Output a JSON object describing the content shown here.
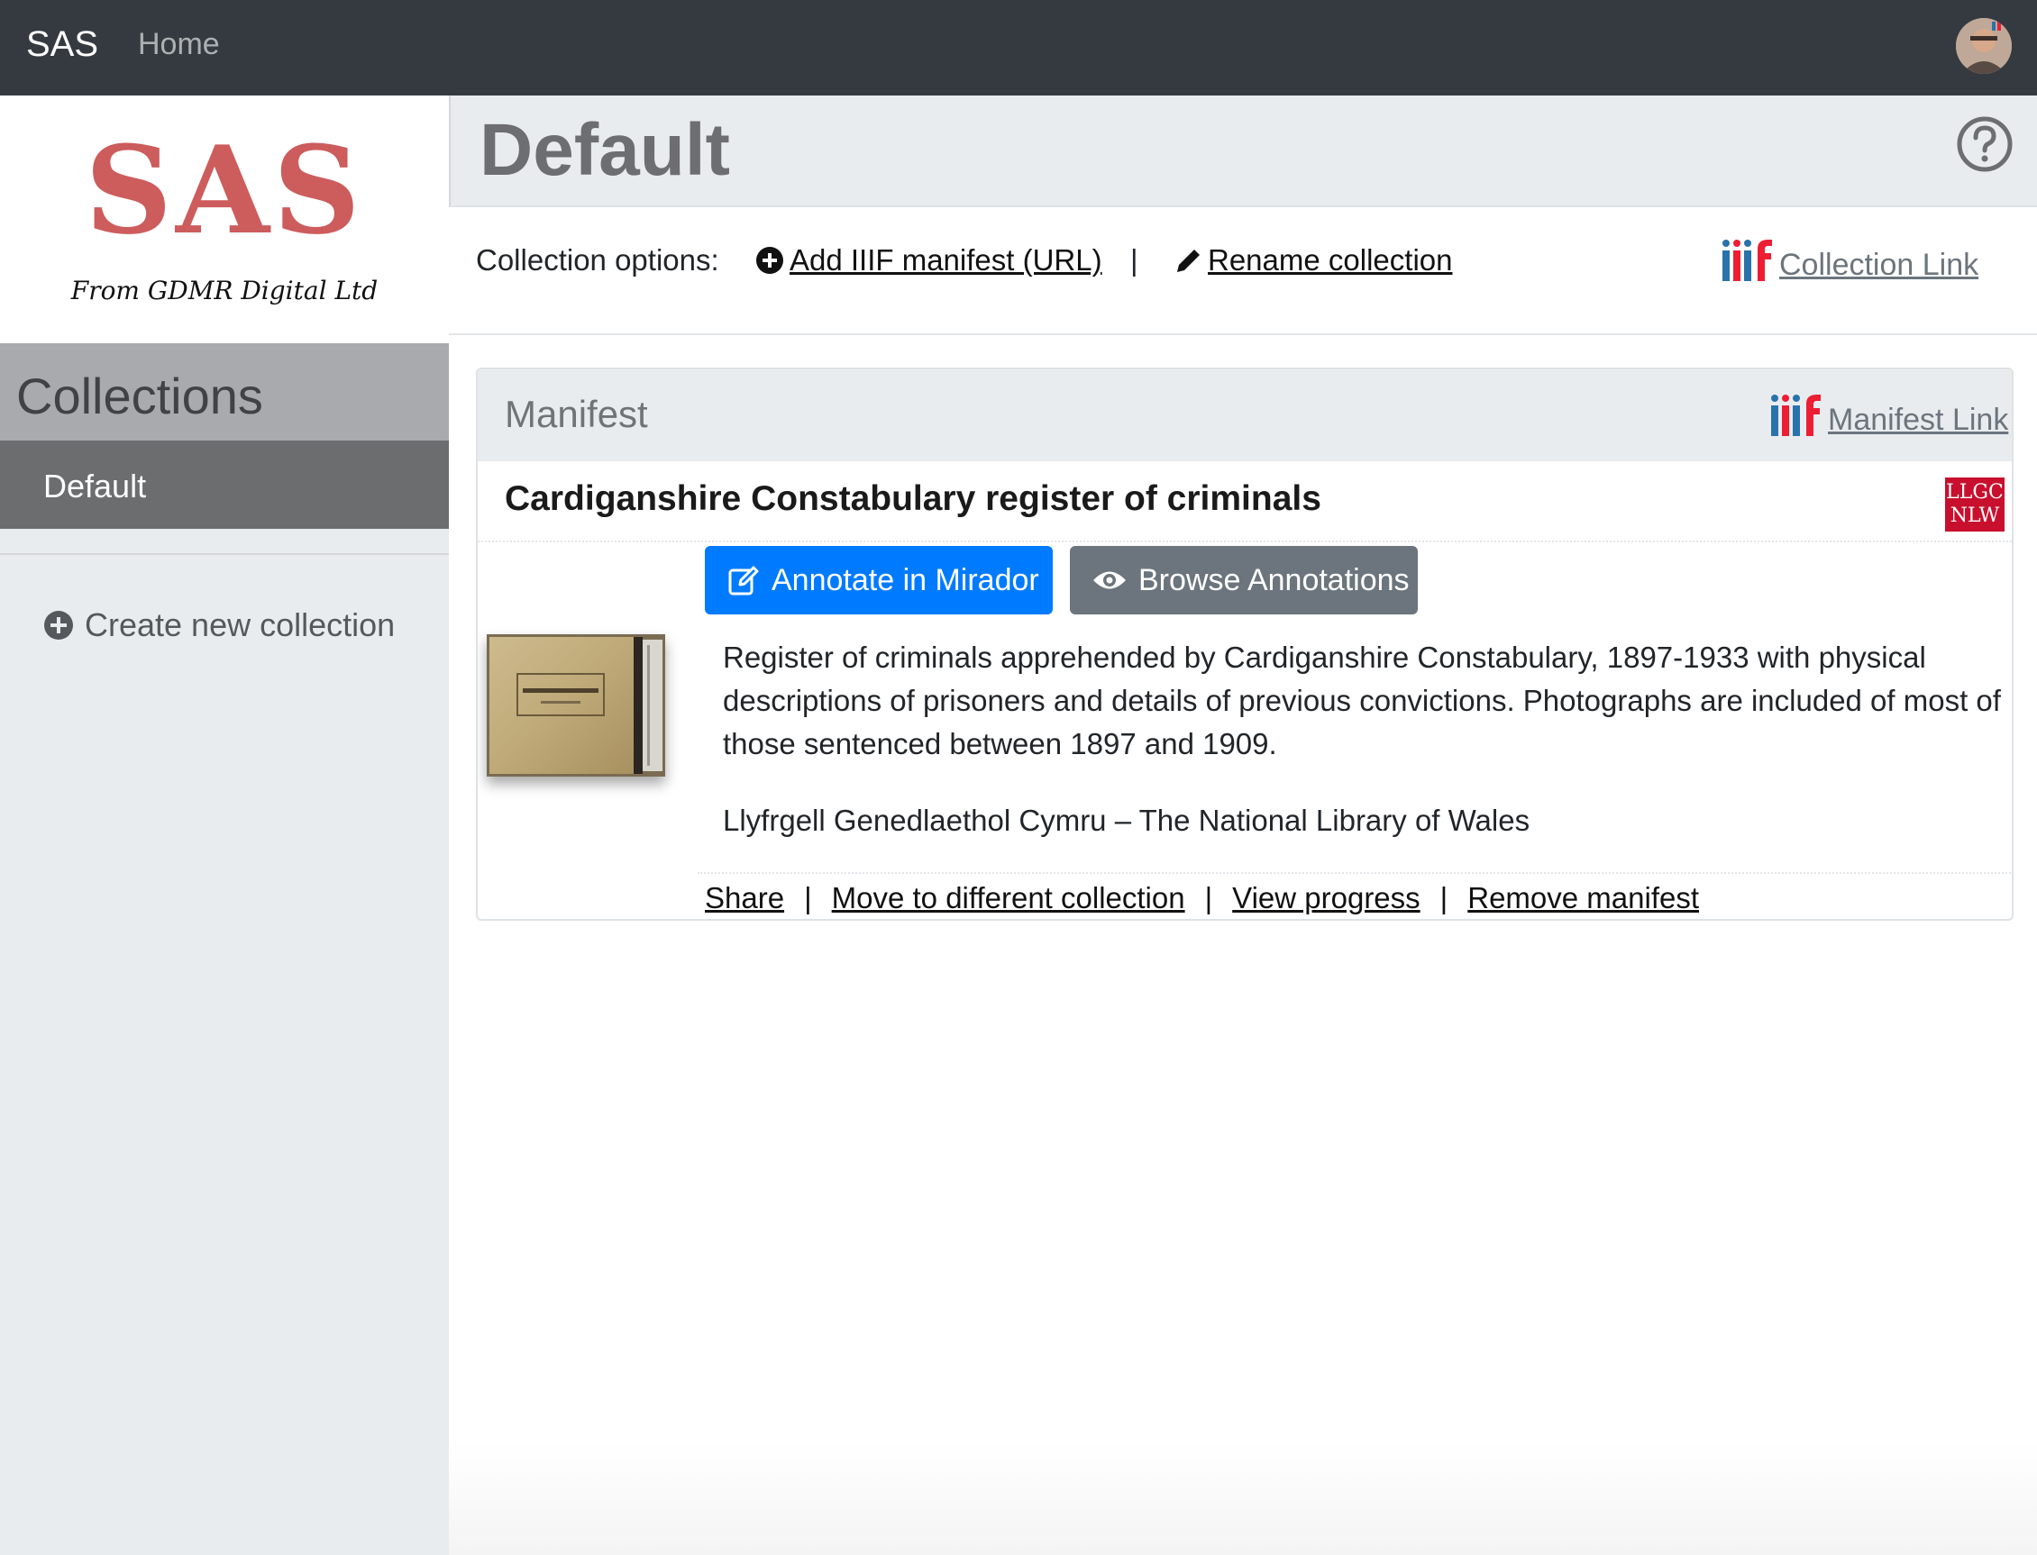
{
  "navbar": {
    "brand": "SAS",
    "home": "Home"
  },
  "sidebar": {
    "logo_text": "SAS",
    "logo_subtitle": "From GDMR Digital Ltd",
    "collections_heading": "Collections",
    "collections": [
      {
        "label": "Default",
        "active": true
      }
    ],
    "create_new": "Create new collection"
  },
  "page": {
    "title": "Default",
    "help_icon": "question-circle-icon"
  },
  "options": {
    "label": "Collection options:",
    "add_manifest": "Add IIIF manifest (URL)",
    "separator": "|",
    "rename": "Rename collection",
    "collection_link": "Collection Link"
  },
  "manifest": {
    "header": "Manifest",
    "manifest_link": "Manifest Link",
    "title": "Cardiganshire Constabulary register of criminals",
    "provider_logo": "LLGC NLW",
    "annotate_button": "Annotate in Mirador",
    "browse_button": "Browse Annotations",
    "description": "Register of criminals apprehended by Cardiganshire Constabulary, 1897-1933 with physical descriptions of prisoners and details of previous convictions. Photographs are included of most of those sentenced between 1897 and 1909.",
    "holder": "Llyfrgell Genedlaethol Cymru – The National Library of Wales",
    "actions": {
      "share": "Share",
      "move": "Move to different collection",
      "progress": "View progress",
      "remove": "Remove manifest",
      "separator": "|"
    }
  },
  "colors": {
    "navbar": "#343a40",
    "logo": "#cd5c5c",
    "primary": "#007bff",
    "secondary": "#6c757d",
    "iiif_blue": "#2873ab",
    "iiif_red": "#ed1d33"
  }
}
